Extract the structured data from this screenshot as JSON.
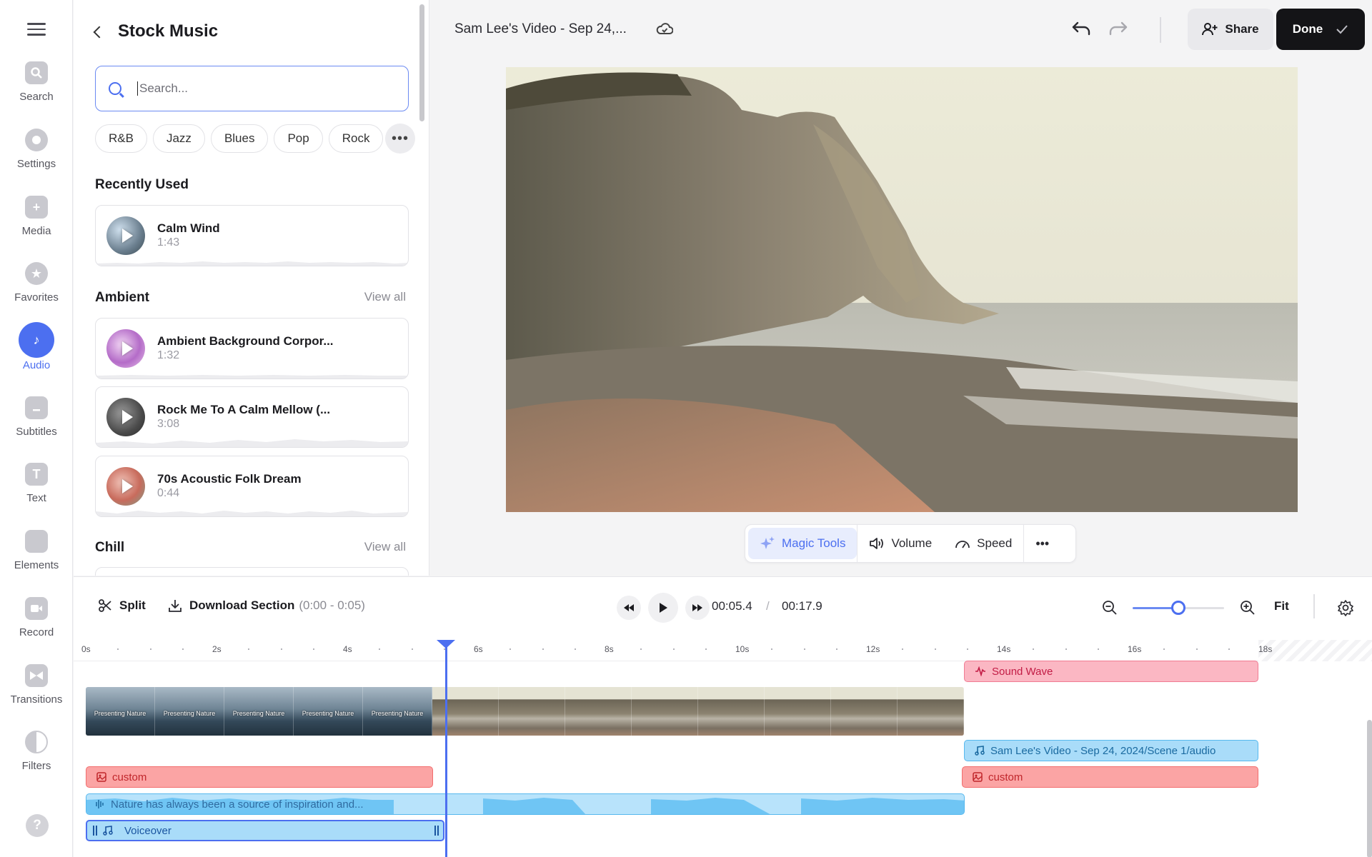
{
  "rail": {
    "items": [
      {
        "label": "Search",
        "icon": "search-icon"
      },
      {
        "label": "Settings",
        "icon": "settings-icon"
      },
      {
        "label": "Media",
        "icon": "media-icon"
      },
      {
        "label": "Favorites",
        "icon": "star-icon"
      },
      {
        "label": "Audio",
        "icon": "music-note-icon",
        "active": true
      },
      {
        "label": "Subtitles",
        "icon": "subtitles-icon"
      },
      {
        "label": "Text",
        "icon": "text-icon"
      },
      {
        "label": "Elements",
        "icon": "elements-icon"
      },
      {
        "label": "Record",
        "icon": "record-icon"
      },
      {
        "label": "Transitions",
        "icon": "transitions-icon"
      },
      {
        "label": "Filters",
        "icon": "filters-icon"
      }
    ],
    "help": "?"
  },
  "panel": {
    "title": "Stock Music",
    "search_placeholder": "Search...",
    "chips": [
      "R&B",
      "Jazz",
      "Blues",
      "Pop",
      "Rock"
    ],
    "more": "•••",
    "recently_used": {
      "title": "Recently Used",
      "tracks": [
        {
          "title": "Calm Wind",
          "duration": "1:43"
        }
      ]
    },
    "ambient": {
      "title": "Ambient",
      "view_all": "View all",
      "tracks": [
        {
          "title": "Ambient Background Corpor...",
          "duration": "1:32"
        },
        {
          "title": "Rock Me To A Calm Mellow (...",
          "duration": "3:08"
        },
        {
          "title": "70s Acoustic Folk Dream",
          "duration": "0:44"
        }
      ]
    },
    "chill": {
      "title": "Chill",
      "view_all": "View all"
    }
  },
  "topbar": {
    "title": "Sam Lee's Video - Sep 24,...",
    "share": "Share",
    "done": "Done"
  },
  "preview_toolbar": {
    "magic": "Magic Tools",
    "volume": "Volume",
    "speed": "Speed",
    "more": "•••"
  },
  "timeline": {
    "split": "Split",
    "download": "Download Section",
    "download_range": "(0:00 - 0:05)",
    "current_time": "00:05.4",
    "separator": "/",
    "total_time": "00:17.9",
    "fit": "Fit",
    "zoom_level": 0.5,
    "ticks": [
      "0s",
      "2s",
      "4s",
      "6s",
      "8s",
      "10s",
      "12s",
      "14s",
      "16s",
      "18s"
    ],
    "clips": {
      "sound_wave": "Sound Wave",
      "scene_audio": "Sam Lee's Video - Sep 24, 2024/Scene 1/audio",
      "custom_1": "custom",
      "custom_2": "custom",
      "narration": "Nature has always been a source of inspiration and...",
      "voiceover": "Voiceover"
    },
    "thumb_caption": "Presenting Nature"
  },
  "colors": {
    "accent": "#4c6ff0",
    "clip_red": "#fba4a4",
    "clip_blue": "#a9dcf9",
    "clip_pink": "#fbb7c3"
  }
}
